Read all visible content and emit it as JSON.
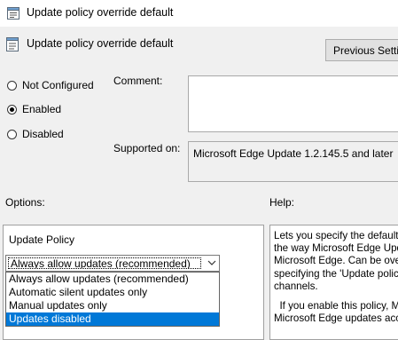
{
  "window": {
    "title": "Update policy override default",
    "icon": "policy-settings-icon"
  },
  "header": {
    "policy_name": "Update policy override default",
    "icon": "policy-setting-icon",
    "previous_setting_label": "Previous Setting"
  },
  "state_options": [
    {
      "label": "Not Configured",
      "checked": false
    },
    {
      "label": "Enabled",
      "checked": true
    },
    {
      "label": "Disabled",
      "checked": false
    }
  ],
  "comment": {
    "label": "Comment:",
    "value": ""
  },
  "supported": {
    "label": "Supported on:",
    "value": "Microsoft Edge Update 1.2.145.5 and later"
  },
  "options": {
    "label": "Options:",
    "field_label": "Update Policy",
    "selected_value": "Always allow updates (recommended)",
    "dropdown_items": [
      {
        "label": "Always allow updates (recommended)",
        "highlighted": false
      },
      {
        "label": "Automatic silent updates only",
        "highlighted": false
      },
      {
        "label": "Manual updates only",
        "highlighted": false
      },
      {
        "label": "Updates disabled",
        "highlighted": true
      }
    ]
  },
  "help": {
    "label": "Help:",
    "lines": [
      "Lets you specify the default",
      "the way Microsoft Edge Upd",
      "Microsoft Edge. Can be over",
      "specifying the 'Update polic",
      "channels.",
      "",
      "  If you enable this policy, M",
      "Microsoft Edge updates acco"
    ]
  },
  "colors": {
    "selection": "#0078d7",
    "window_bg": "#f0f0f0"
  }
}
